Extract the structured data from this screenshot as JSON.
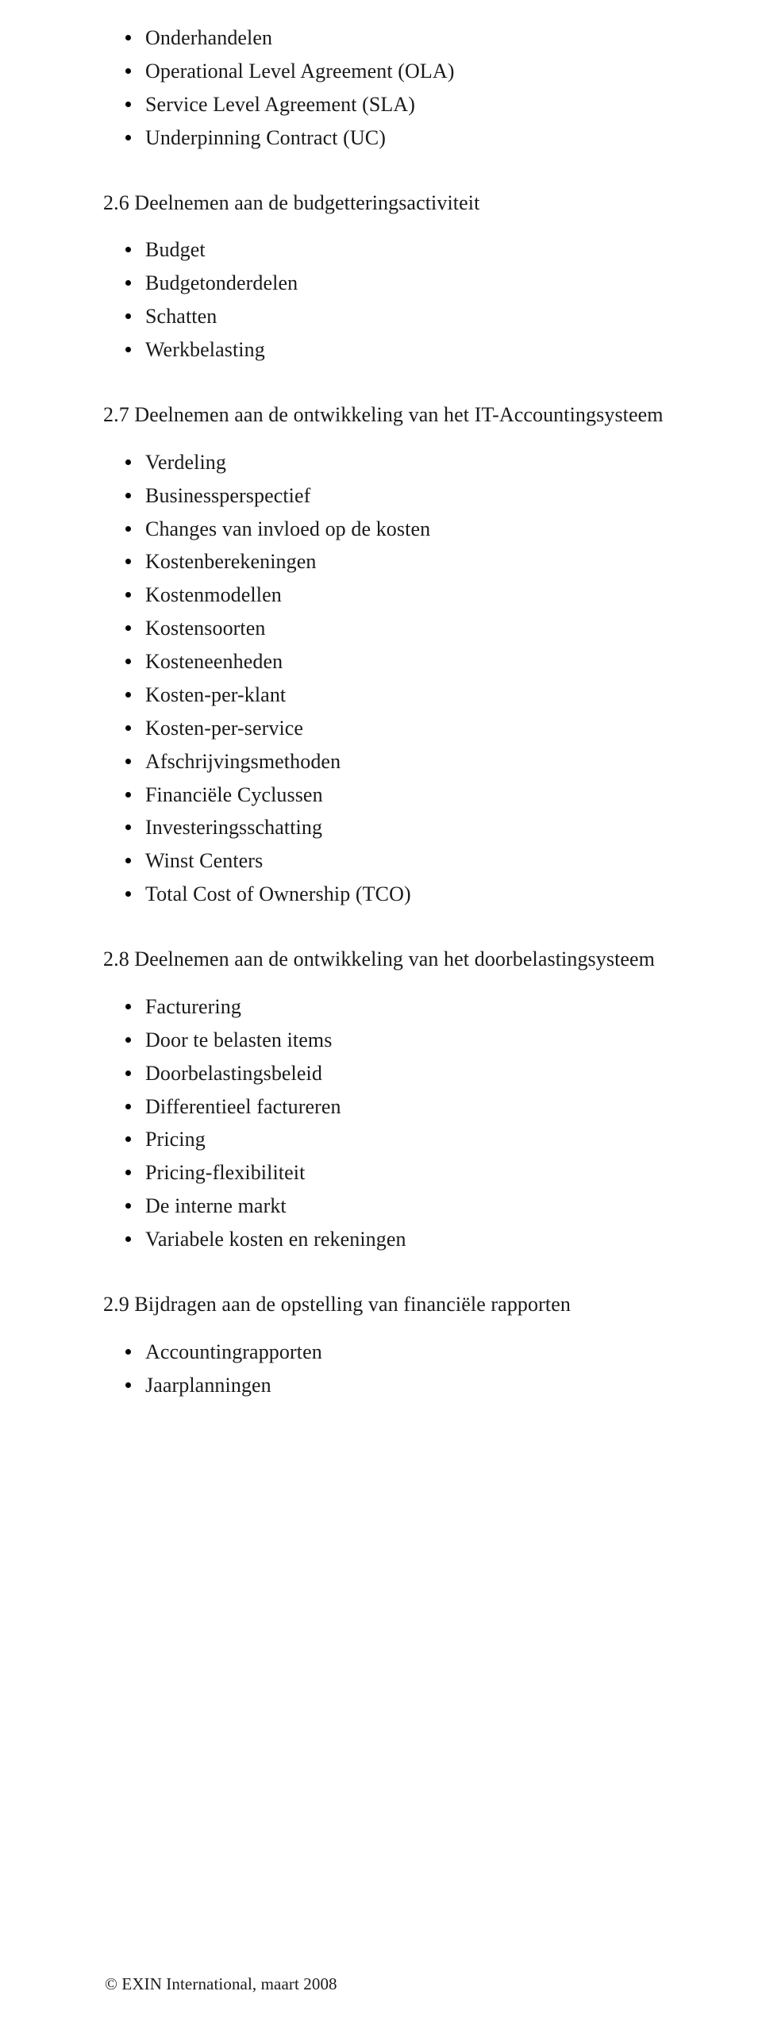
{
  "lead_items": [
    "Onderhandelen",
    "Operational Level Agreement (OLA)",
    "Service Level Agreement (SLA)",
    "Underpinning Contract (UC)"
  ],
  "sections": [
    {
      "heading": "2.6 Deelnemen aan de budgetteringsactiviteit",
      "items": [
        "Budget",
        "Budgetonderdelen",
        "Schatten",
        "Werkbelasting"
      ]
    },
    {
      "heading": "2.7 Deelnemen aan de ontwikkeling van het IT-Accountingsysteem",
      "items": [
        "Verdeling",
        "Businessperspectief",
        "Changes van invloed op de kosten",
        "Kostenberekeningen",
        "Kostenmodellen",
        "Kostensoorten",
        "Kosteneenheden",
        "Kosten-per-klant",
        "Kosten-per-service",
        "Afschrijvingsmethoden",
        "Financiële Cyclussen",
        "Investeringsschatting",
        "Winst Centers",
        "Total Cost of Ownership (TCO)"
      ]
    },
    {
      "heading": "2.8 Deelnemen aan de ontwikkeling van het doorbelastingsysteem",
      "items": [
        "Facturering",
        "Door te belasten items",
        "Doorbelastingsbeleid",
        "Differentieel factureren",
        "Pricing",
        "Pricing-flexibiliteit",
        "De interne markt",
        "Variabele kosten en rekeningen"
      ]
    },
    {
      "heading": "2.9 Bijdragen aan de opstelling van financiële rapporten",
      "items": [
        "Accountingrapporten",
        "Jaarplanningen"
      ]
    }
  ],
  "footer": "© EXIN International, maart 2008"
}
